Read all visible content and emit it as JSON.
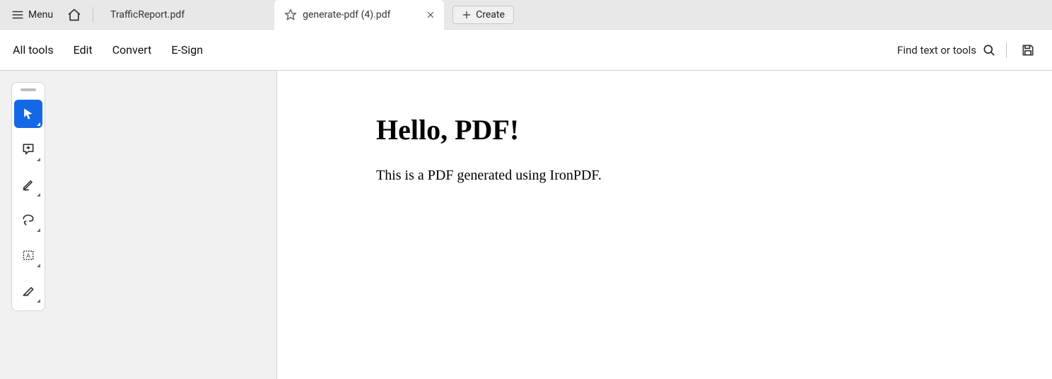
{
  "topbar": {
    "menu_label": "Menu",
    "tabs": [
      {
        "label": "TrafficReport.pdf",
        "active": false
      },
      {
        "label": "generate-pdf (4).pdf",
        "active": true
      }
    ],
    "create_label": "Create"
  },
  "toolbar": {
    "items": [
      "All tools",
      "Edit",
      "Convert",
      "E-Sign"
    ],
    "find_label": "Find text or tools"
  },
  "tools": {
    "names": [
      "select",
      "comment",
      "highlight",
      "lasso",
      "textbox",
      "sign"
    ],
    "active_index": 0
  },
  "document": {
    "heading": "Hello, PDF!",
    "paragraph": "This is a PDF generated using IronPDF."
  }
}
